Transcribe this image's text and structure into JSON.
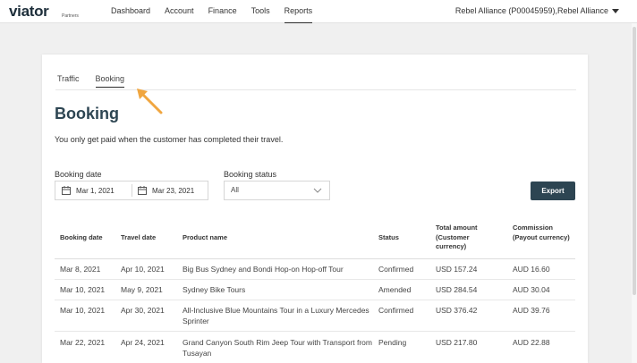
{
  "brand": {
    "logo": "viator",
    "sub": "Partners"
  },
  "nav": {
    "items": [
      {
        "label": "Dashboard"
      },
      {
        "label": "Account"
      },
      {
        "label": "Finance"
      },
      {
        "label": "Tools"
      },
      {
        "label": "Reports"
      }
    ],
    "active": "Reports",
    "account": "Rebel Alliance (P00045959),Rebel Alliance"
  },
  "tabs": [
    {
      "label": "Traffic"
    },
    {
      "label": "Booking"
    }
  ],
  "active_tab": "Booking",
  "page": {
    "title": "Booking",
    "subtitle": "You only get paid when the customer has completed their travel."
  },
  "filters": {
    "booking_date_label": "Booking date",
    "start_date": "Mar 1, 2021",
    "end_date": "Mar 23, 2021",
    "status_label": "Booking status",
    "status_value": "All",
    "export_label": "Export"
  },
  "table": {
    "headers": {
      "booking_date": "Booking date",
      "travel_date": "Travel date",
      "product": "Product name",
      "status": "Status",
      "total": "Total amount (Customer currency)",
      "commission": "Commission (Payout currency)"
    },
    "rows": [
      {
        "booking_date": "Mar 8, 2021",
        "travel_date": "Apr 10, 2021",
        "product": "Big Bus Sydney and Bondi Hop-on Hop-off Tour",
        "status": "Confirmed",
        "total": "USD 157.24",
        "commission": "AUD 16.60"
      },
      {
        "booking_date": "Mar 10, 2021",
        "travel_date": "May 9, 2021",
        "product": "Sydney Bike Tours",
        "status": "Amended",
        "total": "USD 284.54",
        "commission": "AUD 30.04"
      },
      {
        "booking_date": "Mar 10, 2021",
        "travel_date": "Apr 30, 2021",
        "product": "All-Inclusive Blue Mountains Tour in a Luxury Mercedes Sprinter",
        "status": "Confirmed",
        "total": "USD 376.42",
        "commission": "AUD 39.76"
      },
      {
        "booking_date": "Mar 22, 2021",
        "travel_date": "Apr 24, 2021",
        "product": "Grand Canyon South Rim Jeep Tour with Transport from Tusayan",
        "status": "Pending",
        "total": "USD 217.80",
        "commission": "AUD 22.88"
      }
    ]
  },
  "colors": {
    "primary": "#2d4552",
    "pointer": "#f0a640"
  }
}
